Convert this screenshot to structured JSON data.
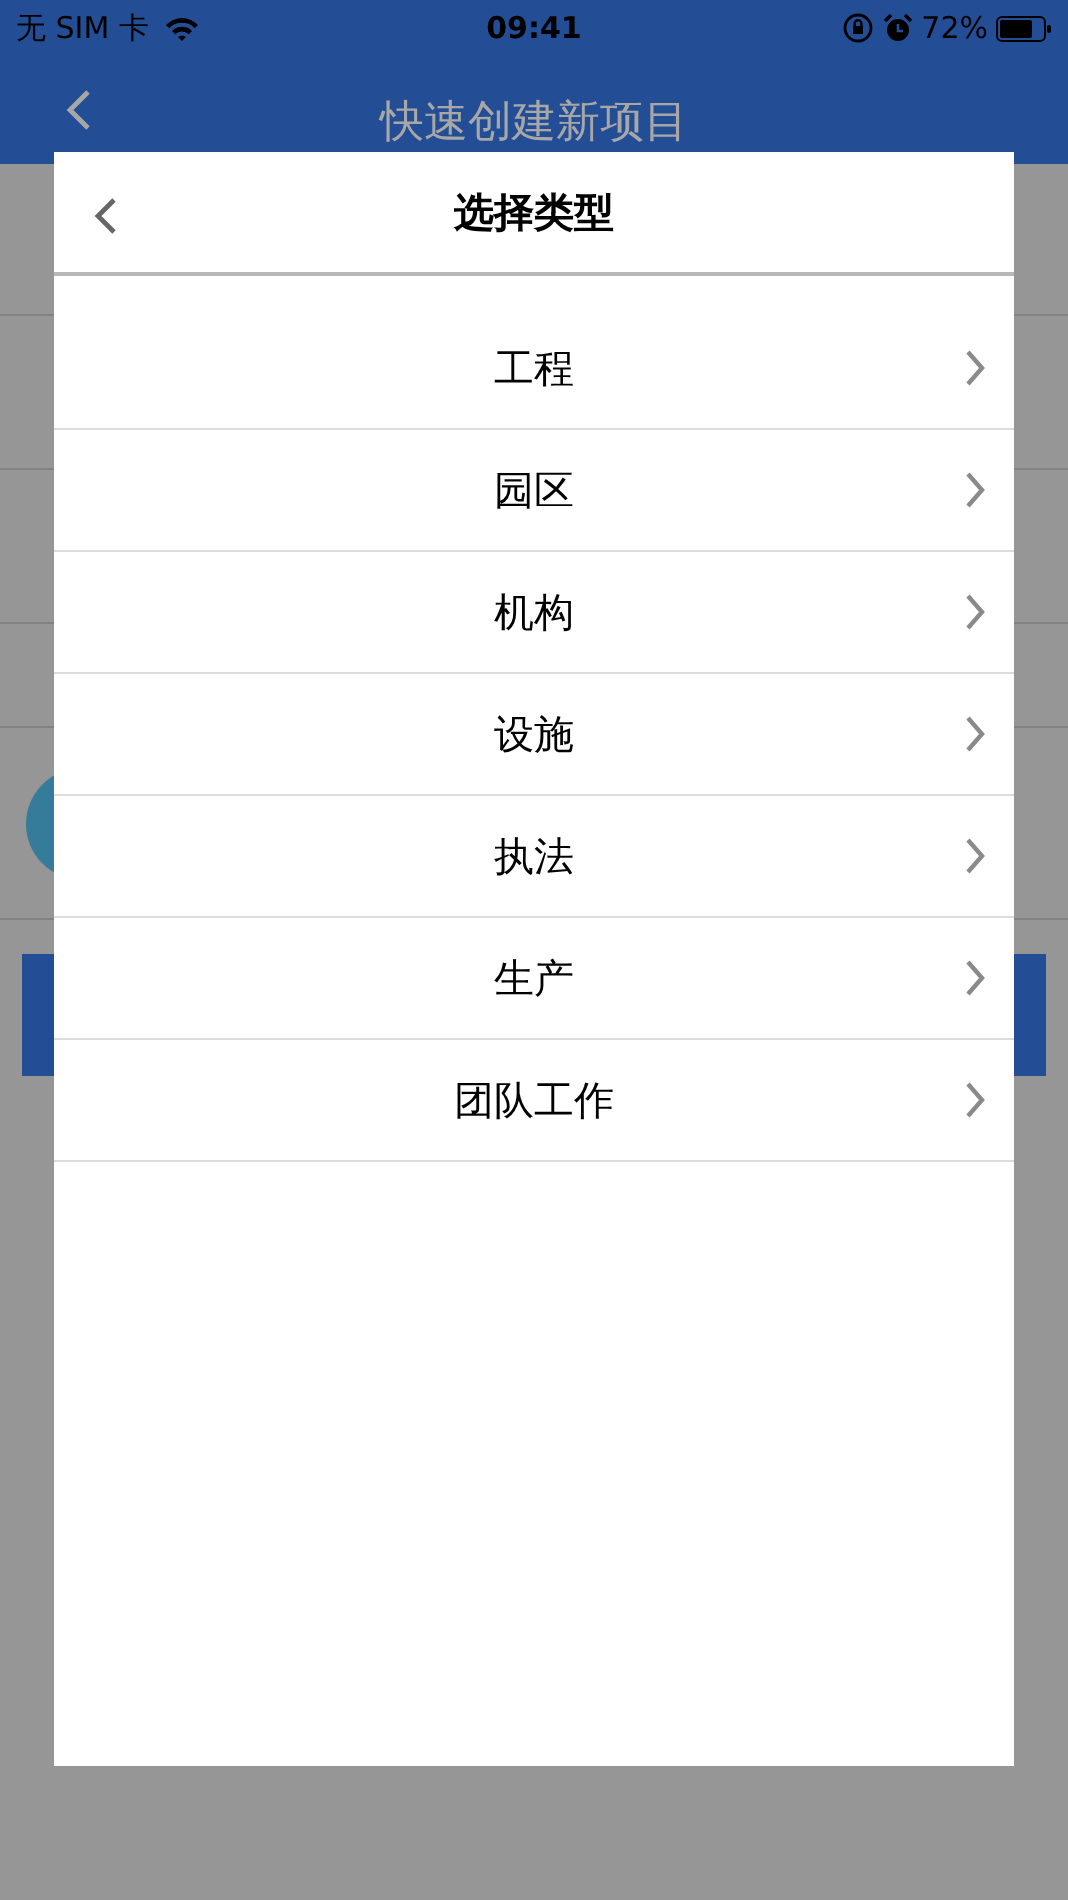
{
  "status_bar": {
    "carrier": "无 SIM 卡",
    "time": "09:41",
    "battery": "72%"
  },
  "nav_bar": {
    "title": "快速创建新项目"
  },
  "dialog": {
    "title": "选择类型",
    "items": [
      {
        "label": "工程"
      },
      {
        "label": "园区"
      },
      {
        "label": "机构"
      },
      {
        "label": "设施"
      },
      {
        "label": "执法"
      },
      {
        "label": "生产"
      },
      {
        "label": "团队工作"
      }
    ]
  }
}
